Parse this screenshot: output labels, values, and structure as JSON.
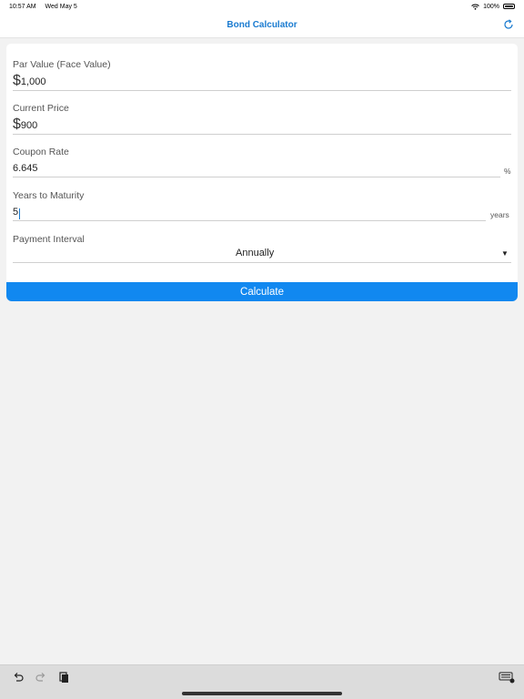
{
  "status_bar": {
    "time": "10:57 AM",
    "date": "Wed May 5",
    "battery": "100%"
  },
  "nav": {
    "title": "Bond Calculator"
  },
  "form": {
    "par_value": {
      "label": "Par Value (Face Value)",
      "prefix": "$",
      "value": "1,000"
    },
    "current_price": {
      "label": "Current Price",
      "prefix": "$",
      "value": "900"
    },
    "coupon_rate": {
      "label": "Coupon Rate",
      "value": "6.645",
      "unit": "%"
    },
    "years_to_maturity": {
      "label": "Years to Maturity",
      "value": "5",
      "unit": "years"
    },
    "payment_interval": {
      "label": "Payment Interval",
      "selected": "Annually"
    }
  },
  "calculate_label": "Calculate",
  "icons": {
    "refresh": "refresh-icon",
    "undo": "undo-icon",
    "redo": "redo-icon",
    "paste": "paste-icon",
    "keyboard": "keyboard-icon"
  },
  "colors": {
    "accent": "#1188f0",
    "title": "#1a7bd0"
  }
}
